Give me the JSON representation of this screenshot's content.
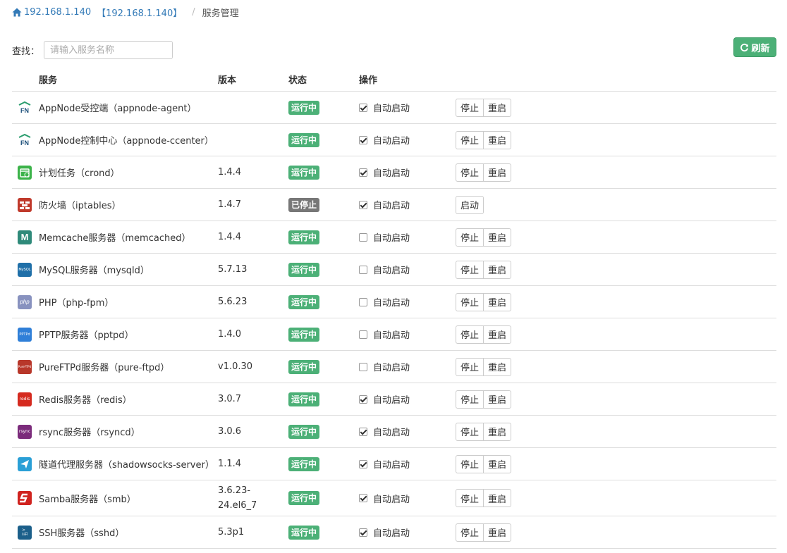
{
  "breadcrumb": {
    "host": "192.168.1.140",
    "host_bracket": "【192.168.1.140】",
    "separator": "/",
    "current": "服务管理"
  },
  "search": {
    "label": "查找：",
    "placeholder": "请输入服务名称"
  },
  "toolbar": {
    "refresh_label": "刷新"
  },
  "table": {
    "headers": {
      "service": "服务",
      "version": "版本",
      "status": "状态",
      "action": "操作"
    },
    "rows": [
      {
        "name": "AppNode受控端（appnode-agent）",
        "version": "",
        "status": "运行中",
        "running": true,
        "auto_label": "自动启动",
        "auto": true,
        "icon": "appnode-icon",
        "icon_color": "#ffffff",
        "buttons": [
          "停止",
          "重启"
        ]
      },
      {
        "name": "AppNode控制中心（appnode-ccenter）",
        "version": "",
        "status": "运行中",
        "running": true,
        "auto_label": "自动启动",
        "auto": true,
        "icon": "appnode-icon",
        "icon_color": "#ffffff",
        "buttons": [
          "停止",
          "重启"
        ]
      },
      {
        "name": "计划任务（crond）",
        "version": "1.4.4",
        "status": "运行中",
        "running": true,
        "auto_label": "自动启动",
        "auto": true,
        "icon": "calendar-icon",
        "icon_color": "#3cb34a",
        "buttons": [
          "停止",
          "重启"
        ]
      },
      {
        "name": "防火墙（iptables）",
        "version": "1.4.7",
        "status": "已停止",
        "running": false,
        "auto_label": "自动启动",
        "auto": true,
        "icon": "firewall-icon",
        "icon_color": "#c0392b",
        "buttons": [
          "启动"
        ]
      },
      {
        "name": "Memcache服务器（memcached）",
        "version": "1.4.4",
        "status": "运行中",
        "running": true,
        "auto_label": "自动启动",
        "auto": false,
        "icon": "memcache-icon",
        "icon_color": "#2f8a7a",
        "buttons": [
          "停止",
          "重启"
        ]
      },
      {
        "name": "MySQL服务器（mysqld）",
        "version": "5.7.13",
        "status": "运行中",
        "running": true,
        "auto_label": "自动启动",
        "auto": false,
        "icon": "mysql-icon",
        "icon_color": "#1f6fa8",
        "buttons": [
          "停止",
          "重启"
        ]
      },
      {
        "name": "PHP（php-fpm）",
        "version": "5.6.23",
        "status": "运行中",
        "running": true,
        "auto_label": "自动启动",
        "auto": false,
        "icon": "php-icon",
        "icon_color": "#8892bf",
        "buttons": [
          "停止",
          "重启"
        ]
      },
      {
        "name": "PPTP服务器（pptpd）",
        "version": "1.4.0",
        "status": "运行中",
        "running": true,
        "auto_label": "自动启动",
        "auto": false,
        "icon": "pptp-icon",
        "icon_color": "#2f7fd8",
        "buttons": [
          "停止",
          "重启"
        ]
      },
      {
        "name": "PureFTPd服务器（pure-ftpd）",
        "version": "v1.0.30",
        "status": "运行中",
        "running": true,
        "auto_label": "自动启动",
        "auto": false,
        "icon": "pureftpd-icon",
        "icon_color": "#b8372a",
        "buttons": [
          "停止",
          "重启"
        ]
      },
      {
        "name": "Redis服务器（redis）",
        "version": "3.0.7",
        "status": "运行中",
        "running": true,
        "auto_label": "自动启动",
        "auto": true,
        "icon": "redis-icon",
        "icon_color": "#d52a1f",
        "buttons": [
          "停止",
          "重启"
        ]
      },
      {
        "name": "rsync服务器（rsyncd）",
        "version": "3.0.6",
        "status": "运行中",
        "running": true,
        "auto_label": "自动启动",
        "auto": true,
        "icon": "rsync-icon",
        "icon_color": "#7b2b7b",
        "buttons": [
          "停止",
          "重启"
        ]
      },
      {
        "name": "隧道代理服务器（shadowsocks-server）",
        "version": "1.1.4",
        "status": "运行中",
        "running": true,
        "auto_label": "自动启动",
        "auto": true,
        "icon": "paper-plane-icon",
        "icon_color": "#2a9fd6",
        "buttons": [
          "停止",
          "重启"
        ]
      },
      {
        "name": "Samba服务器（smb）",
        "version": "3.6.23-24.el6_7",
        "status": "运行中",
        "running": true,
        "auto_label": "自动启动",
        "auto": true,
        "icon": "samba-icon",
        "icon_color": "#d0231f",
        "buttons": [
          "停止",
          "重启"
        ]
      },
      {
        "name": "SSH服务器（sshd）",
        "version": "5.3p1",
        "status": "运行中",
        "running": true,
        "auto_label": "自动启动",
        "auto": true,
        "icon": "terminal-icon",
        "icon_color": "#1b5f8a",
        "buttons": [
          "停止",
          "重启"
        ]
      }
    ]
  },
  "icon_text": {
    "mysql": "MySQL",
    "php": "php",
    "pptp": "PPTPd",
    "pureftpd": "PureFTPd",
    "redis": "redis",
    "rsync": "rsync",
    "ssh": "SSH",
    "ssh_prompt": ">_",
    "memcache": "M",
    "appnode": "FN"
  }
}
